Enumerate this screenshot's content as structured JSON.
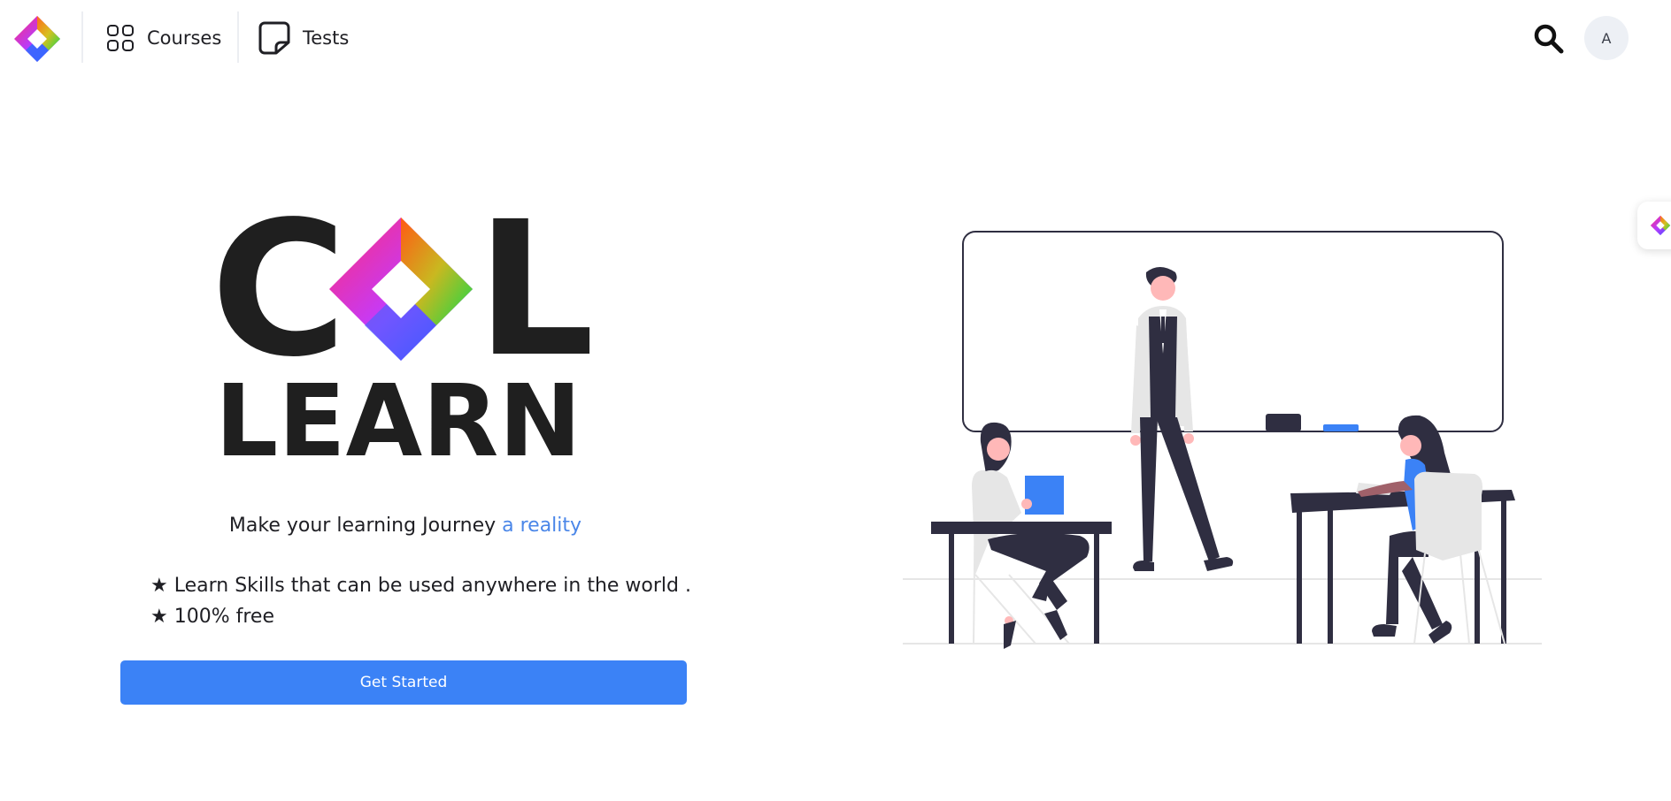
{
  "header": {
    "nav": [
      {
        "label": "Courses",
        "icon": "grid-icon"
      },
      {
        "label": "Tests",
        "icon": "sticky-note-icon"
      }
    ],
    "search_icon": "search-icon",
    "avatar_initial": "A"
  },
  "hero": {
    "logo_text_top_left": "C",
    "logo_text_top_right": "L",
    "logo_text_bottom": "LEARN",
    "tagline_prefix": "Make your learning Journey ",
    "tagline_accent": "a reality",
    "bullets": [
      "★ Learn Skills that can be used anywhere in the world .",
      "★ 100% free"
    ],
    "cta_label": "Get Started"
  },
  "colors": {
    "accent": "#3b82f6",
    "link": "#4a86e8",
    "text": "#1f1f24",
    "illustration_dark": "#2f2e41",
    "illustration_blue": "#3b82f6"
  }
}
